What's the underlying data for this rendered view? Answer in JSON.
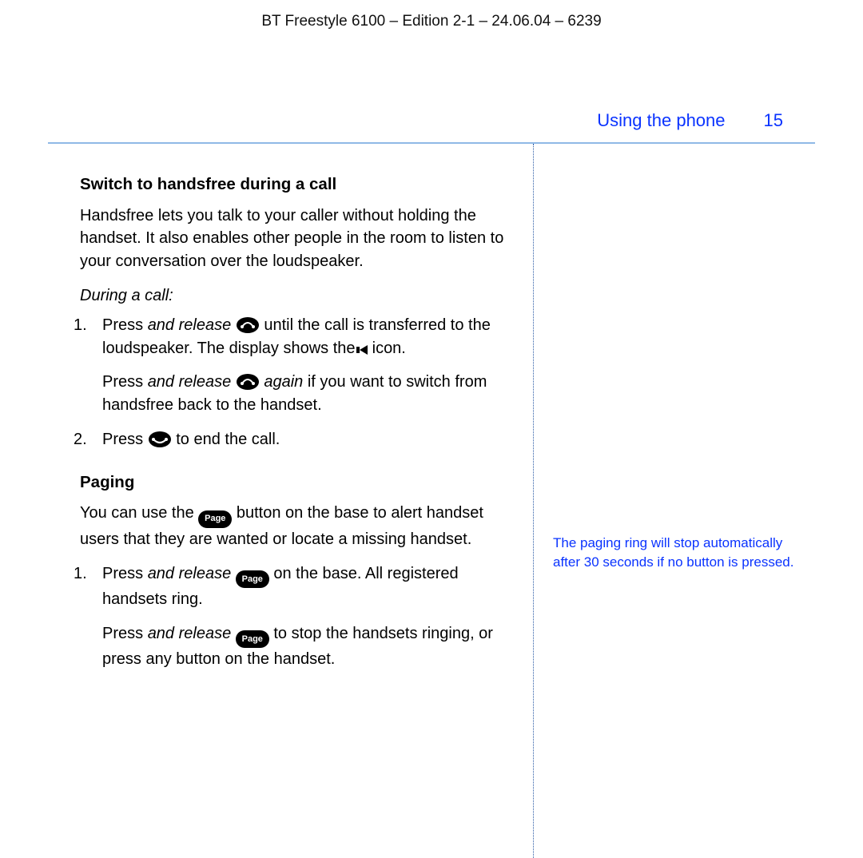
{
  "doc_header": "BT Freestyle 6100 – Edition 2-1 – 24.06.04 – 6239",
  "running_section": "Using the phone",
  "page_number": "15",
  "section1": {
    "heading": "Switch to handsfree during a call",
    "intro": "Handsfree lets you talk to your caller without holding the handset. It also enables other people in the room to listen to your conversation over the loudspeaker.",
    "subhead": "During a call:",
    "step1a_pre": "Press ",
    "step1a_em": "and release",
    "step1a_post": " until the call is transferred to the loudspeaker. The display shows the ",
    "step1a_tail": " icon.",
    "step1b_pre": "Press ",
    "step1b_em": "and release",
    "step1b_mid": " ",
    "step1b_em2": "again",
    "step1b_post": " if you want to switch from handsfree back to the handset.",
    "step2_pre": "Press ",
    "step2_post": " to end the call."
  },
  "section2": {
    "heading": "Paging",
    "intro_pre": "You can use the ",
    "intro_post": " button on the base to alert handset users that they are wanted or locate a missing handset.",
    "step1a_pre": "Press ",
    "step1a_em": "and release",
    "step1a_post": " on the base. All registered handsets ring.",
    "step1b_pre": "Press ",
    "step1b_em": "and release",
    "step1b_post": " to stop the handsets ringing, or press any button on the handset."
  },
  "sidebar_note": "The paging ring will stop automatically after 30 seconds if no button is pressed.",
  "icons": {
    "handsfree_button_label": "",
    "endcall_button_label": "",
    "page_button_label": "Page"
  }
}
